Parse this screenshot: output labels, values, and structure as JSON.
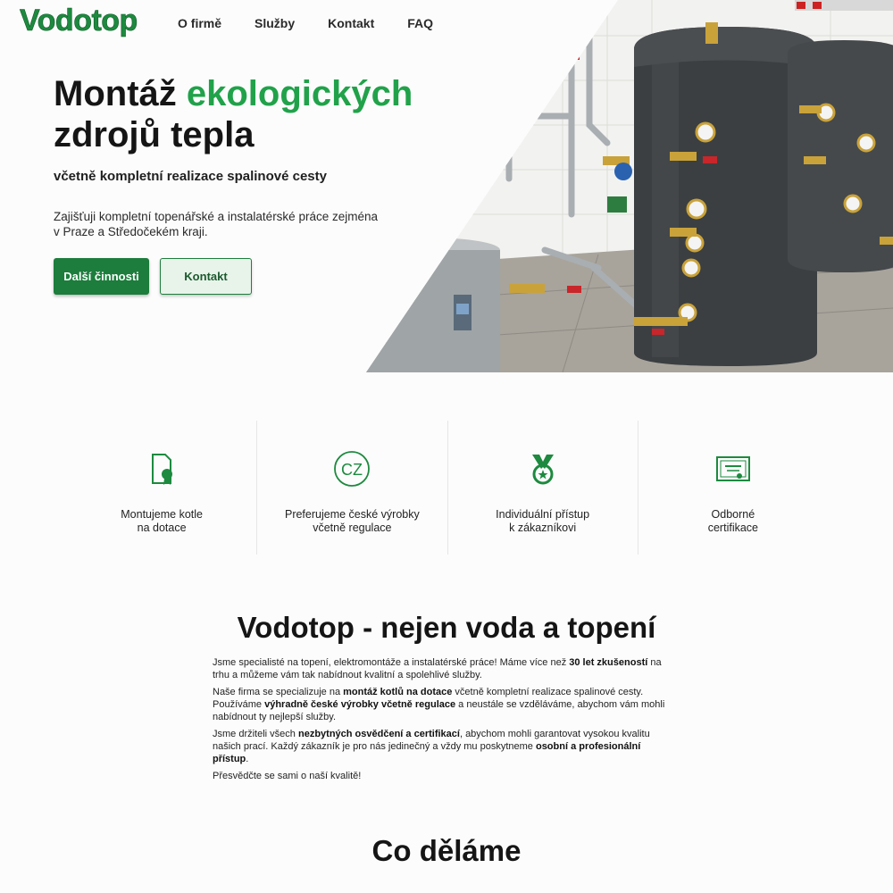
{
  "brand": {
    "logo": "Vodotop",
    "accent_color": "#1d8a3f"
  },
  "nav": {
    "items": [
      "O firmě",
      "Služby",
      "Kontakt",
      "FAQ"
    ]
  },
  "hero": {
    "title_part1": "Montáž ",
    "title_accent": "ekologických",
    "title_part2": "zdrojů tepla",
    "subtitle": "včetně kompletní realizace spalinové cesty",
    "description": "Zajišťuji kompletní topenářské a instalatérské práce zejména v Praze a Středočekém kraji.",
    "primary_button": "Další činnosti",
    "secondary_button": "Kontakt"
  },
  "features": [
    {
      "icon": "document-seal-icon",
      "line1": "Montujeme kotle",
      "line2": "na dotace"
    },
    {
      "icon": "cz-badge-icon",
      "line1": "Preferujeme české výrobky",
      "line2": "včetně regulace",
      "badge_text": "CZ"
    },
    {
      "icon": "medal-icon",
      "line1": "Individuální přístup",
      "line2": "k zákazníkovi"
    },
    {
      "icon": "certificate-icon",
      "line1": "Odborné",
      "line2": "certifikace"
    }
  ],
  "about": {
    "title": "Vodotop - nejen voda a topení",
    "p1": [
      "Jsme specialisté na topení, elektromontáže a instalatérské práce! Máme více než ",
      "30 let zkušeností",
      " na trhu a můžeme vám tak nabídnout kvalitní a spolehlivé služby."
    ],
    "p2": [
      "Naše firma se specializuje na ",
      "montáž kotlů na dotace",
      " včetně kompletní realizace spalinové cesty. Používáme ",
      "výhradně české výrobky včetně regulace",
      " a neustále se vzděláváme, abychom vám mohli nabídnout ty nejlepší služby."
    ],
    "p3": [
      "Jsme držiteli všech ",
      "nezbytných osvědčení a certifikací",
      ", abychom mohli garantovat vysokou kvalitu našich prací. Každý zákazník je pro nás jedinečný a vždy mu poskytneme ",
      "osobní a profesionální přístup",
      "."
    ],
    "p4": "Přesvědčte se sami o naší kvalitě!"
  },
  "services": {
    "title": "Co děláme"
  }
}
